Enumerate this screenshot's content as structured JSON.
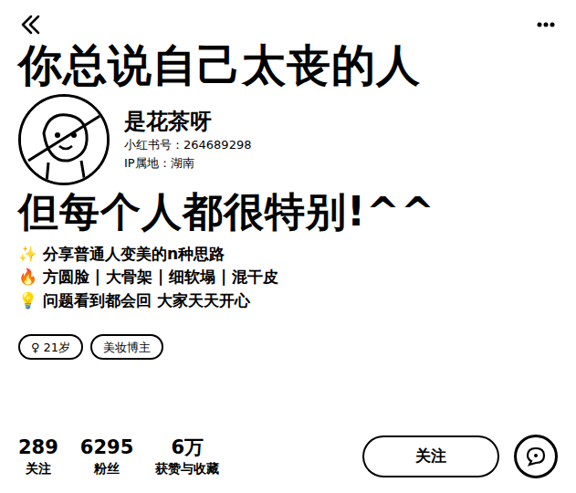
{
  "overlay": {
    "lines": [
      "你总说自己太丧的人",
      "但每个人都很特别!^^"
    ]
  },
  "profile": {
    "name": "是花茶呀",
    "id": "小红书号：264689298",
    "ip": "IP属地：湖南"
  },
  "bio": [
    "✨ 分享普通人变美的n种思路",
    "🔥 方圆脸 | 大骨架 | 细软塌 | 混干皮",
    "💡 问题看到都会回 大家天天开心"
  ],
  "tags": [
    {
      "icon": "♀",
      "label": "21岁"
    },
    {
      "icon": "",
      "label": "美妆博主"
    }
  ],
  "stats": [
    {
      "value": "289",
      "label": "关注"
    },
    {
      "value": "6295",
      "label": "粉丝"
    },
    {
      "value": "6万",
      "label": "获赞与收藏"
    }
  ],
  "buttons": {
    "follow": "关注"
  }
}
